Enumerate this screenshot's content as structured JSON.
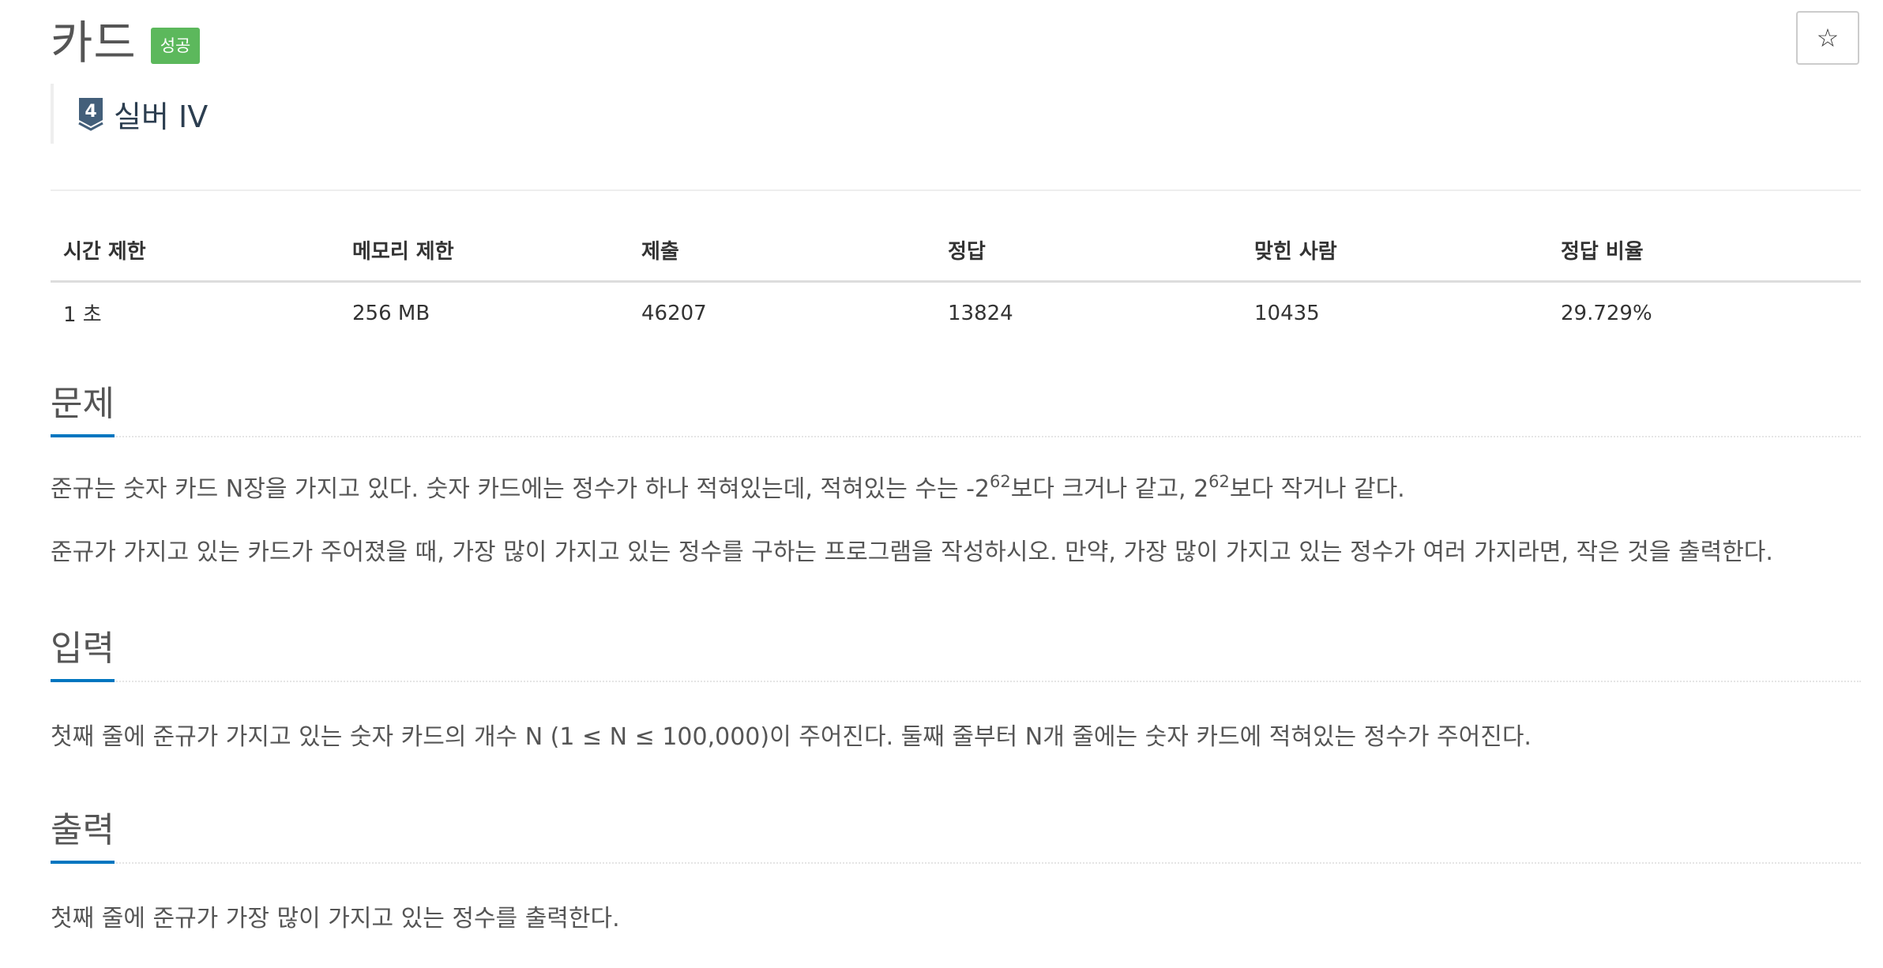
{
  "problem": {
    "title": "카드",
    "status_badge": "성공",
    "star_label": "☆",
    "tier": {
      "number": "4",
      "label": "실버 IV",
      "color": "#435f7a"
    }
  },
  "info_table": {
    "headers": [
      "시간 제한",
      "메모리 제한",
      "제출",
      "정답",
      "맞힌 사람",
      "정답 비율"
    ],
    "values": [
      "1 초",
      "256 MB",
      "46207",
      "13824",
      "10435",
      "29.729%"
    ]
  },
  "sections": {
    "description": {
      "title": "문제",
      "p1_part1": "준규는 숫자 카드 N장을 가지고 있다. 숫자 카드에는 정수가 하나 적혀있는데, 적혀있는 수는 -2",
      "p1_sup1": "62",
      "p1_part2": "보다 크거나 같고, 2",
      "p1_sup2": "62",
      "p1_part3": "보다 작거나 같다.",
      "p2": "준규가 가지고 있는 카드가 주어졌을 때, 가장 많이 가지고 있는 정수를 구하는 프로그램을 작성하시오. 만약, 가장 많이 가지고 있는 정수가 여러 가지라면, 작은 것을 출력한다."
    },
    "input": {
      "title": "입력",
      "text": "첫째 줄에 준규가 가지고 있는 숫자 카드의 개수 N (1 ≤ N ≤ 100,000)이 주어진다. 둘째 줄부터 N개 줄에는 숫자 카드에 적혀있는 정수가 주어진다."
    },
    "output": {
      "title": "출력",
      "text": "첫째 줄에 준규가 가장 많이 가지고 있는 정수를 출력한다."
    }
  },
  "colors": {
    "badge_success": "#5cb85c",
    "section_underline": "#0076c0"
  }
}
